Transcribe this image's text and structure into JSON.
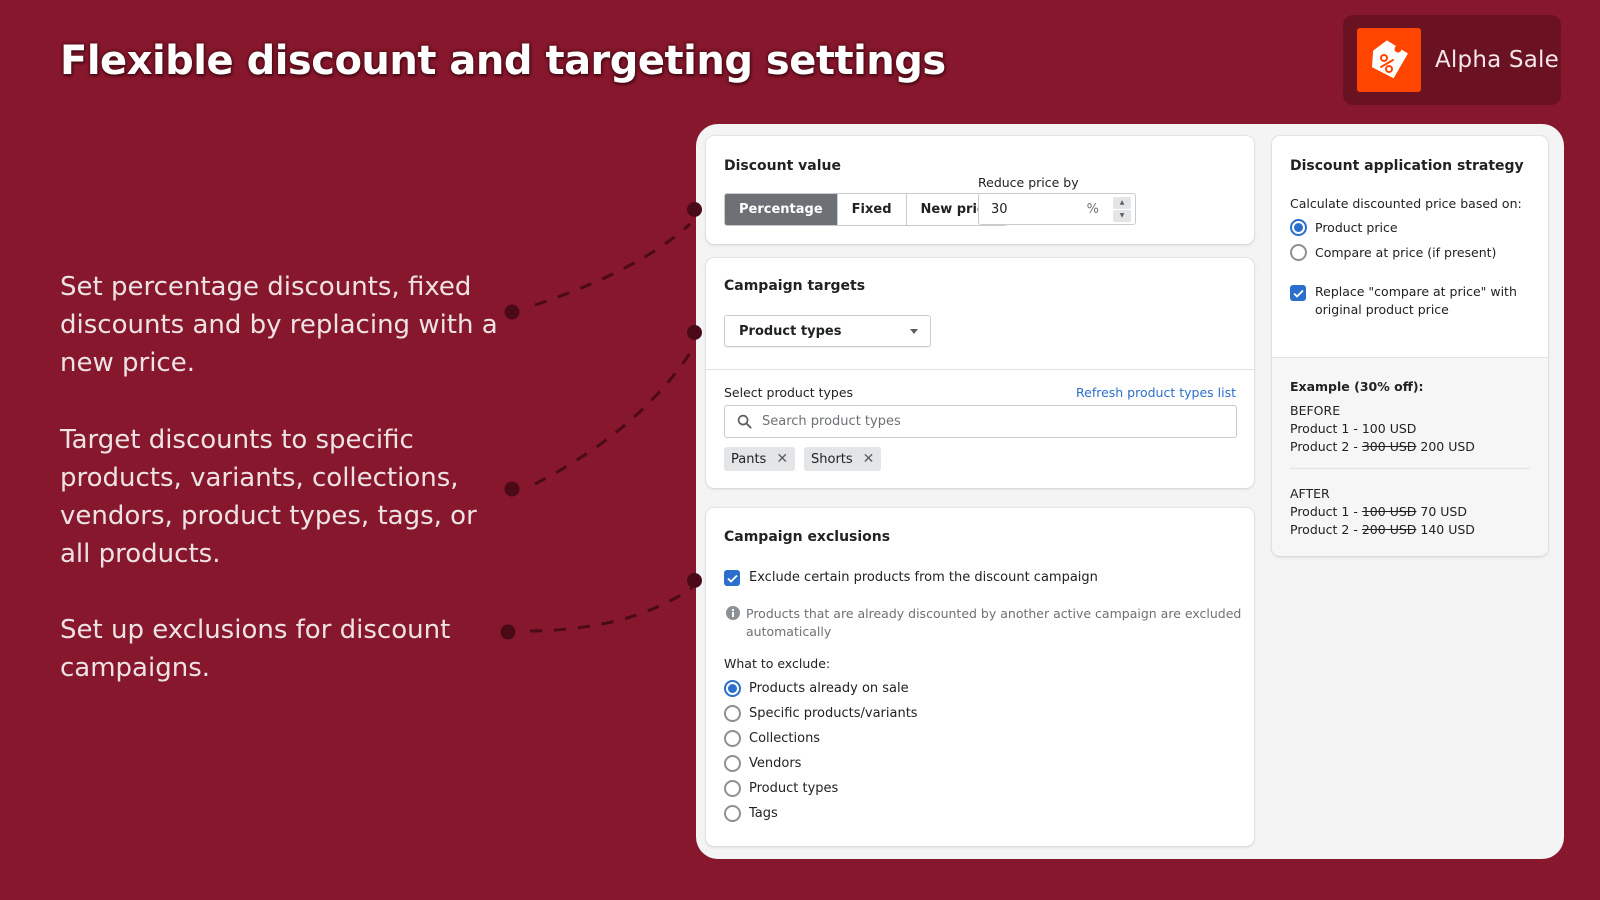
{
  "header": {
    "title": "Flexible discount and targeting settings",
    "brand_name": "Alpha Sale",
    "brand_color": "#ff4500"
  },
  "features": [
    "Set percentage discounts, fixed discounts and by replacing with a new price.",
    "Target discounts to specific products, variants, collections, vendors, product types, tags, or all products.",
    "Set up exclusions for discount campaigns."
  ],
  "discount_value": {
    "title": "Discount value",
    "types": [
      "Percentage",
      "Fixed",
      "New price"
    ],
    "selected_type": "Percentage",
    "reduce_label": "Reduce price by",
    "reduce_value": "30",
    "reduce_suffix": "%"
  },
  "campaign_targets": {
    "title": "Campaign targets",
    "target_type": "Product types",
    "select_label": "Select product types",
    "refresh_link": "Refresh product types list",
    "search_placeholder": "Search product types",
    "tags": [
      "Pants",
      "Shorts"
    ]
  },
  "campaign_exclusions": {
    "title": "Campaign exclusions",
    "exclude_checkbox_label": "Exclude certain products from the discount campaign",
    "exclude_checked": true,
    "info_line1": "Products that are already discounted by another active campaign are excluded",
    "info_line2": "automatically",
    "what_label": "What to exclude:",
    "options": [
      "Products already on sale",
      "Specific products/variants",
      "Collections",
      "Vendors",
      "Product types",
      "Tags"
    ],
    "selected_option": "Products already on sale"
  },
  "strategy": {
    "title": "Discount application strategy",
    "calc_label": "Calculate discounted price based on:",
    "options": [
      "Product price",
      "Compare at price (if present)"
    ],
    "selected_option": "Product price",
    "replace_line1": "Replace \"compare at price\" with",
    "replace_line2": "original product price",
    "replace_checked": true,
    "example": {
      "title": "Example (30% off):",
      "before_label": "BEFORE",
      "before": [
        {
          "label": "Product 1 - ",
          "old": "",
          "new": "100 USD"
        },
        {
          "label": "Product 2 - ",
          "old": "300 USD",
          "new": "200 USD"
        }
      ],
      "after_label": "AFTER",
      "after": [
        {
          "label": "Product 1 - ",
          "old": "100 USD",
          "new": "70 USD"
        },
        {
          "label": "Product 2 - ",
          "old": "200 USD",
          "new": "140 USD"
        }
      ]
    }
  }
}
